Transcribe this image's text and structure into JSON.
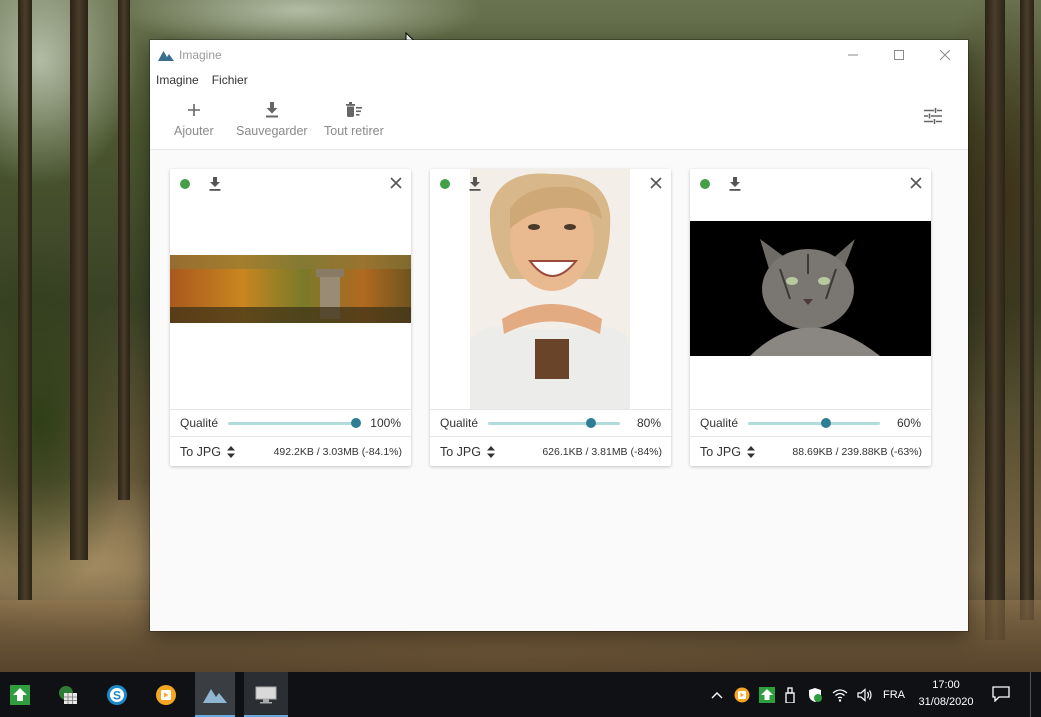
{
  "window": {
    "title": "Imagine",
    "minimize_icon": "minimize-icon",
    "maximize_icon": "maximize-icon",
    "close_icon": "close-icon"
  },
  "menu": [
    "Imagine",
    "Fichier"
  ],
  "toolbar": {
    "add_label": "Ajouter",
    "save_label": "Sauvegarder",
    "remove_all_label": "Tout retirer",
    "settings_icon": "sliders-icon"
  },
  "accent_color": "#2e7d95",
  "status_color": "#43a047",
  "cards": [
    {
      "preview": "autumn-forest-castle-image",
      "quality_label": "Qualité",
      "quality": 100,
      "quality_text": "100%",
      "format": "To JPG",
      "size_text": "492.2KB / 3.03MB (-84.1%)"
    },
    {
      "preview": "smiling-woman-image",
      "quality_label": "Qualité",
      "quality": 80,
      "quality_text": "80%",
      "format": "To JPG",
      "size_text": "626.1KB / 3.81MB (-84%)"
    },
    {
      "preview": "tabby-cat-image",
      "quality_label": "Qualité",
      "quality": 60,
      "quality_text": "60%",
      "format": "To JPG",
      "size_text": "88.69KB / 239.88KB (-63%)"
    }
  ],
  "taskbar": {
    "pinned": [
      "green-upload-icon",
      "spreadsheet-icon",
      "skype-icon",
      "media-player-icon",
      "imagine-icon",
      "remote-desktop-icon"
    ],
    "tray_language": "FRA",
    "time": "17:00",
    "date": "31/08/2020"
  }
}
